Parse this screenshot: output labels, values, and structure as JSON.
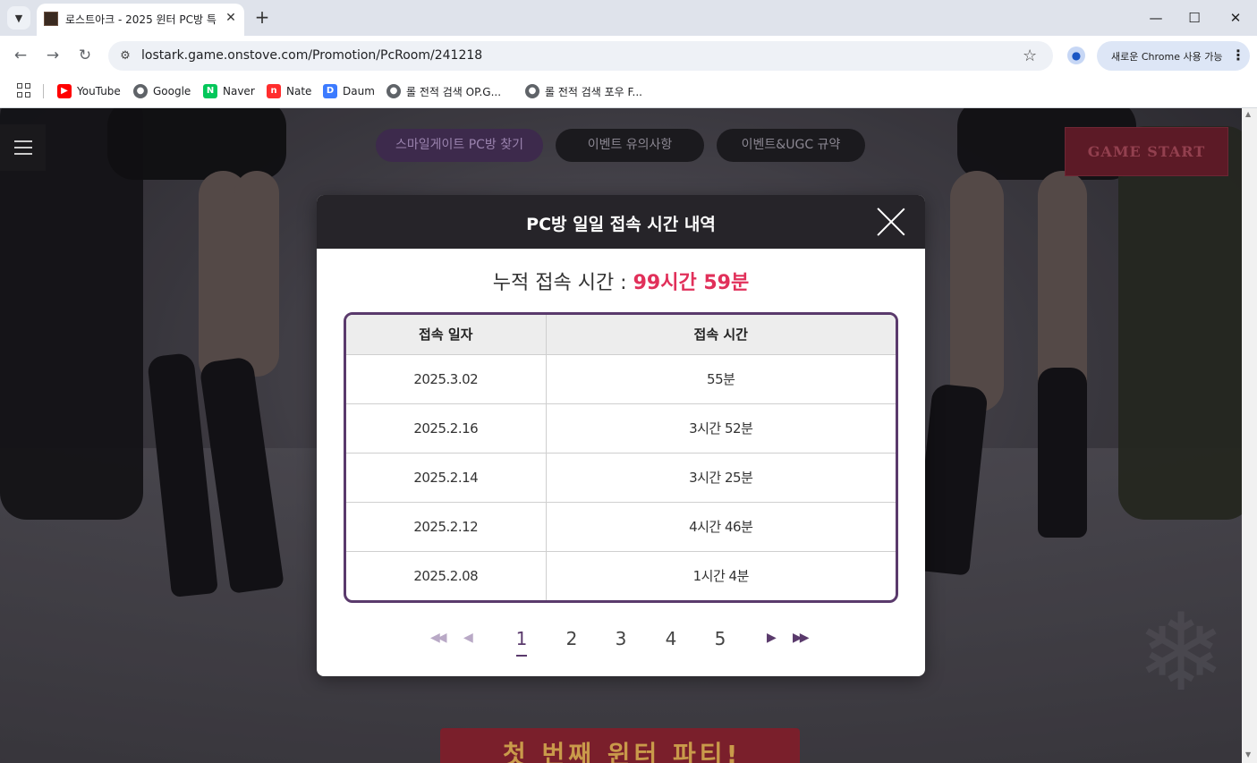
{
  "browser": {
    "tab_title": "로스트아크 - 2025 윈터 PC방 특",
    "url": "lostark.game.onstove.com/Promotion/PcRoom/241218",
    "chrome_pill": "새로운 Chrome 사용 가능",
    "bookmarks": [
      {
        "label": "YouTube",
        "icon": "youtube-icon",
        "color": "#ff0000"
      },
      {
        "label": "Google",
        "icon": "globe-icon",
        "color": "#5f6368"
      },
      {
        "label": "Naver",
        "icon": "naver-icon",
        "color": "#03c75a"
      },
      {
        "label": "Nate",
        "icon": "nate-icon",
        "color": "#ff2d2d"
      },
      {
        "label": "Daum",
        "icon": "daum-icon",
        "color": "#3c7bff"
      },
      {
        "label": "롤 전적 검색 OP.G...",
        "icon": "globe-icon",
        "color": "#5f6368"
      },
      {
        "label": "롤 전적 검색 포우 F...",
        "icon": "globe-icon",
        "color": "#5f6368"
      }
    ]
  },
  "page": {
    "nav": [
      "스마일게이트 PC방 찾기",
      "이벤트 유의사항",
      "이벤트&UGC 규약"
    ],
    "game_start": "GAME START",
    "banner_text": "첫 번째 윈터 파티!"
  },
  "modal": {
    "title": "PC방 일일 접속 시간 내역",
    "total_label": "누적 접속 시간 : ",
    "total_value": "99시간 59분",
    "columns": [
      "접속 일자",
      "접속 시간"
    ],
    "rows": [
      {
        "date": "2025.3.02",
        "time": "55분"
      },
      {
        "date": "2025.2.16",
        "time": "3시간 52분"
      },
      {
        "date": "2025.2.14",
        "time": "3시간 25분"
      },
      {
        "date": "2025.2.12",
        "time": "4시간 46분"
      },
      {
        "date": "2025.2.08",
        "time": "1시간 4분"
      }
    ],
    "pages": [
      "1",
      "2",
      "3",
      "4",
      "5"
    ],
    "current_page": "1",
    "accent": "#5a3a6c",
    "highlight": "#e1305a"
  }
}
